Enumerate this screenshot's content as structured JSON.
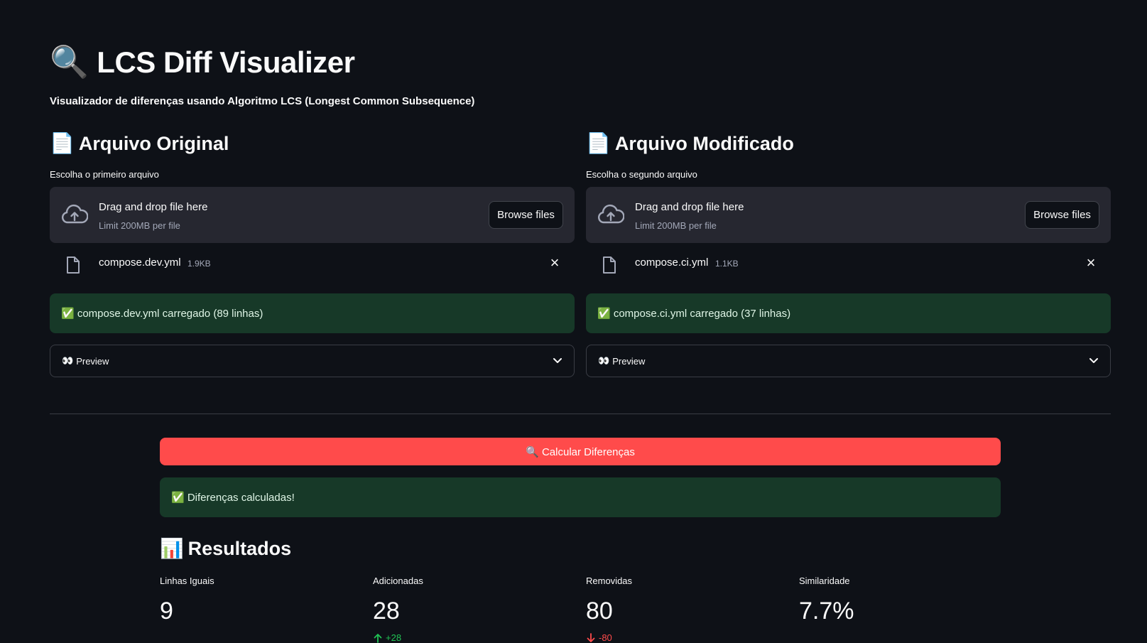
{
  "header": {
    "title_emoji": "🔍",
    "title": "LCS Diff Visualizer",
    "subtitle": "Visualizador de diferenças usando Algoritmo LCS (Longest Common Subsequence)"
  },
  "original": {
    "heading_emoji": "📄",
    "heading": "Arquivo Original",
    "uploader_label": "Escolha o primeiro arquivo",
    "drop_title": "Drag and drop file here",
    "drop_limit": "Limit 200MB per file",
    "browse_label": "Browse files",
    "file_name": "compose.dev.yml",
    "file_size": "1.9KB",
    "success_message": "✅ compose.dev.yml carregado (89 linhas)",
    "expander_icon": "👀",
    "expander_label": "Preview"
  },
  "modified": {
    "heading_emoji": "📄",
    "heading": "Arquivo Modificado",
    "uploader_label": "Escolha o segundo arquivo",
    "drop_title": "Drag and drop file here",
    "drop_limit": "Limit 200MB per file",
    "browse_label": "Browse files",
    "file_name": "compose.ci.yml",
    "file_size": "1.1KB",
    "success_message": "✅ compose.ci.yml carregado (37 linhas)",
    "expander_icon": "👀",
    "expander_label": "Preview"
  },
  "actions": {
    "calculate_label": "🔍 Calcular Diferenças",
    "calculated_message": "✅ Diferenças calculadas!"
  },
  "results": {
    "heading_emoji": "📊",
    "heading": "Resultados",
    "metrics": [
      {
        "label": "Linhas Iguais",
        "value": "9",
        "delta": ""
      },
      {
        "label": "Adicionadas",
        "value": "28",
        "delta": "+28",
        "direction": "up"
      },
      {
        "label": "Removidas",
        "value": "80",
        "delta": "-80",
        "direction": "down"
      },
      {
        "label": "Similaridade",
        "value": "7.7%",
        "delta": ""
      }
    ]
  },
  "colors": {
    "background": "#0e1117",
    "surface": "#262730",
    "primary_button": "#ff4b4b",
    "success_bg": "#173928",
    "delta_up": "#21c354",
    "delta_down": "#ff4b4b"
  },
  "icons": {
    "upload": "cloud-upload-icon",
    "file": "file-icon",
    "close": "close-icon",
    "expand": "chevron-down-icon",
    "arrow_up": "arrow-up-icon",
    "arrow_down": "arrow-down-icon"
  }
}
